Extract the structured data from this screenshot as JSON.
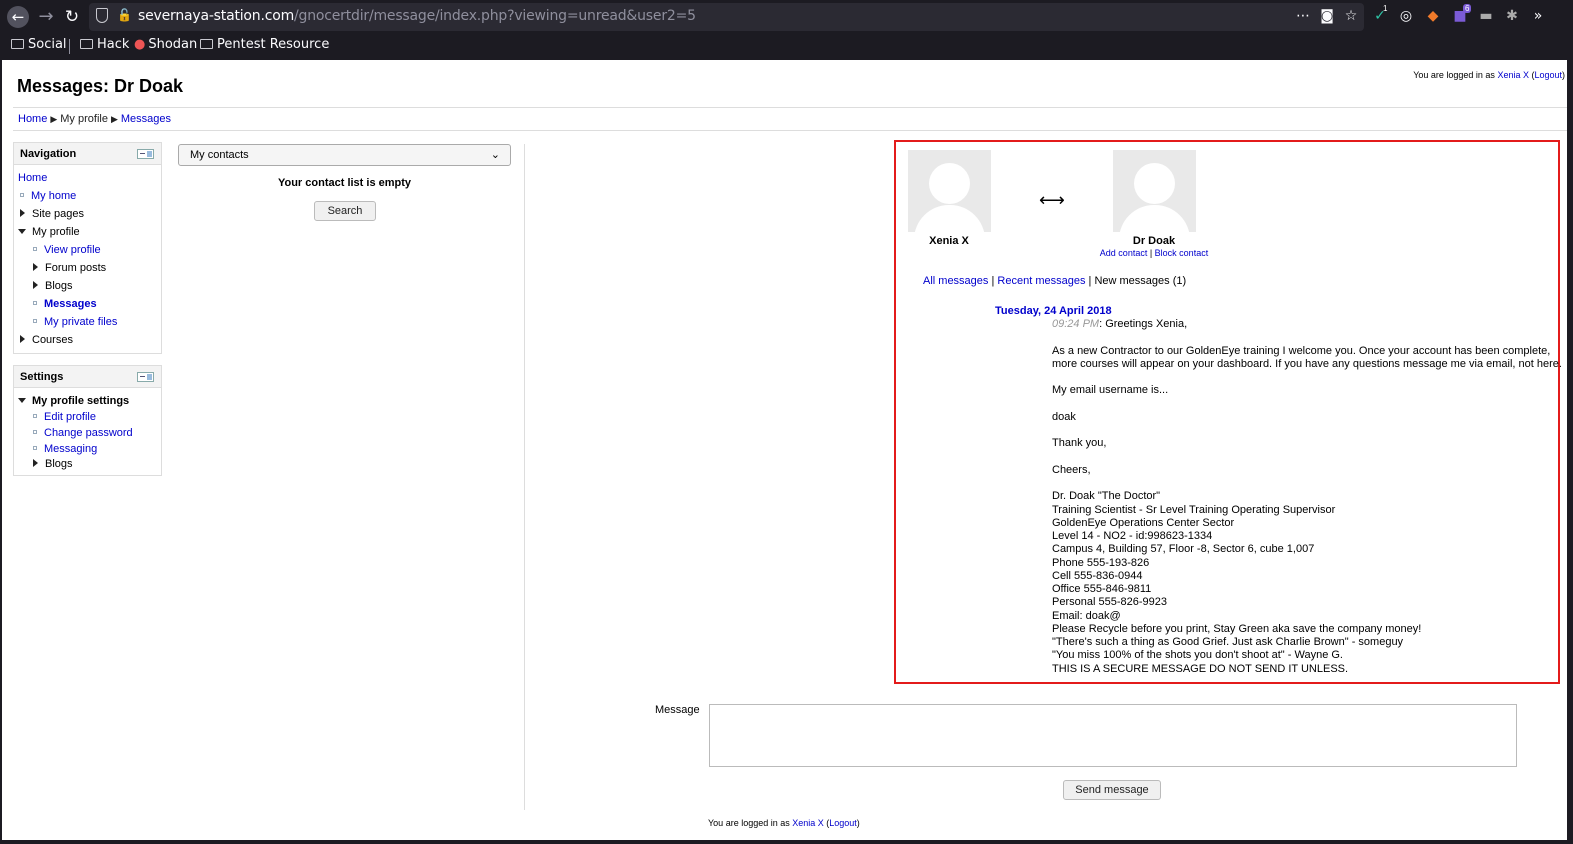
{
  "browser": {
    "url_host": "severnaya-station.com",
    "url_path": "/gnocertdir/message/index.php?viewing=unread&user2=5",
    "bookmarks": [
      "Social",
      "Hack",
      "Shodan",
      "Pentest Resource"
    ],
    "extension_badges": [
      "1",
      "6"
    ]
  },
  "page": {
    "title": "Messages: Dr Doak",
    "login": {
      "prefix": "You are logged in as ",
      "user": "Xenia X",
      "logout": "Logout"
    }
  },
  "breadcrumb": [
    "Home",
    "My profile",
    "Messages"
  ],
  "navigation": {
    "title": "Navigation",
    "items": [
      "Home",
      "My home",
      "Site pages",
      "My profile",
      "View profile",
      "Forum posts",
      "Blogs",
      "Messages",
      "My private files",
      "Courses"
    ]
  },
  "settings": {
    "title": "Settings",
    "items": [
      "My profile settings",
      "Edit profile",
      "Change password",
      "Messaging",
      "Blogs"
    ]
  },
  "contacts": {
    "select_value": "My contacts",
    "empty_text": "Your contact list is empty",
    "search_label": "Search"
  },
  "conversation": {
    "user1": "Xenia X",
    "user2": "Dr Doak",
    "add_contact": "Add contact",
    "block_contact": "Block contact",
    "filter_all": "All messages",
    "filter_recent": "Recent messages",
    "filter_new": "New messages (1)",
    "date": "Tuesday, 24 April 2018",
    "time": "09:24 PM",
    "body": ": Greetings Xenia,\n\nAs a new Contractor to our GoldenEye training I welcome you. Once your account has been complete,\nmore courses will appear on your dashboard. If you have any questions message me via email, not here.\n\nMy email username is...\n\ndoak\n\nThank you,\n\nCheers,\n\nDr. Doak \"The Doctor\"\nTraining Scientist - Sr Level Training Operating Supervisor\nGoldenEye Operations Center Sector\nLevel 14 - NO2 - id:998623-1334\nCampus 4, Building 57, Floor -8, Sector 6, cube 1,007\nPhone 555-193-826\nCell 555-836-0944\nOffice 555-846-9811\nPersonal 555-826-9923\nEmail: doak@\nPlease Recycle before you print, Stay Green aka save the company money!\n\"There's such a thing as Good Grief. Just ask Charlie Brown\" - someguy\n\"You miss 100% of the shots you don't shoot at\" - Wayne G.\nTHIS IS A SECURE MESSAGE DO NOT SEND IT UNLESS."
  },
  "compose": {
    "label": "Message",
    "value": "",
    "send_label": "Send message"
  }
}
